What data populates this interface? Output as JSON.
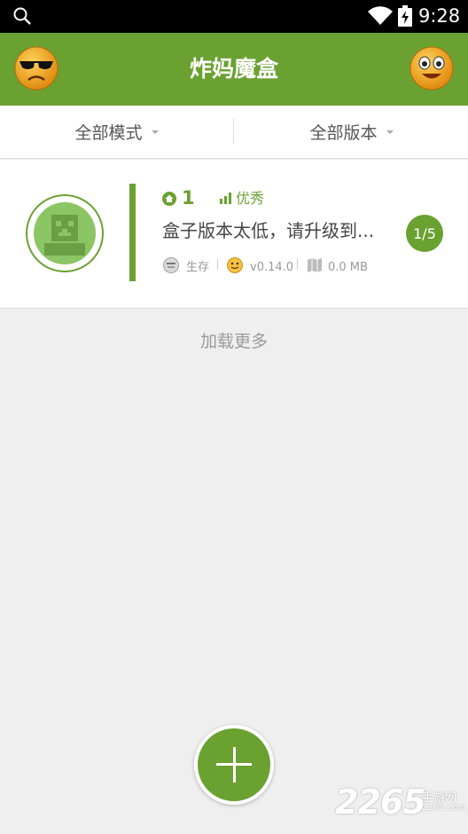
{
  "status_bar": {
    "time": "9:28"
  },
  "app_bar": {
    "title": "炸妈魔盒"
  },
  "filters": {
    "mode": "全部模式",
    "version": "全部版本"
  },
  "items": [
    {
      "count": "1",
      "quality": "优秀",
      "title": "盒子版本太低，请升级到...",
      "page_badge": "1/5",
      "mode": "生存",
      "version": "v0.14.0",
      "size": "0.0 MB"
    }
  ],
  "load_more": "加载更多",
  "watermark": {
    "number": "2265",
    "label": "手游网",
    "url": "2265.com"
  },
  "colors": {
    "accent": "#6aa131",
    "background": "#efefef",
    "status_bar": "#000000"
  }
}
